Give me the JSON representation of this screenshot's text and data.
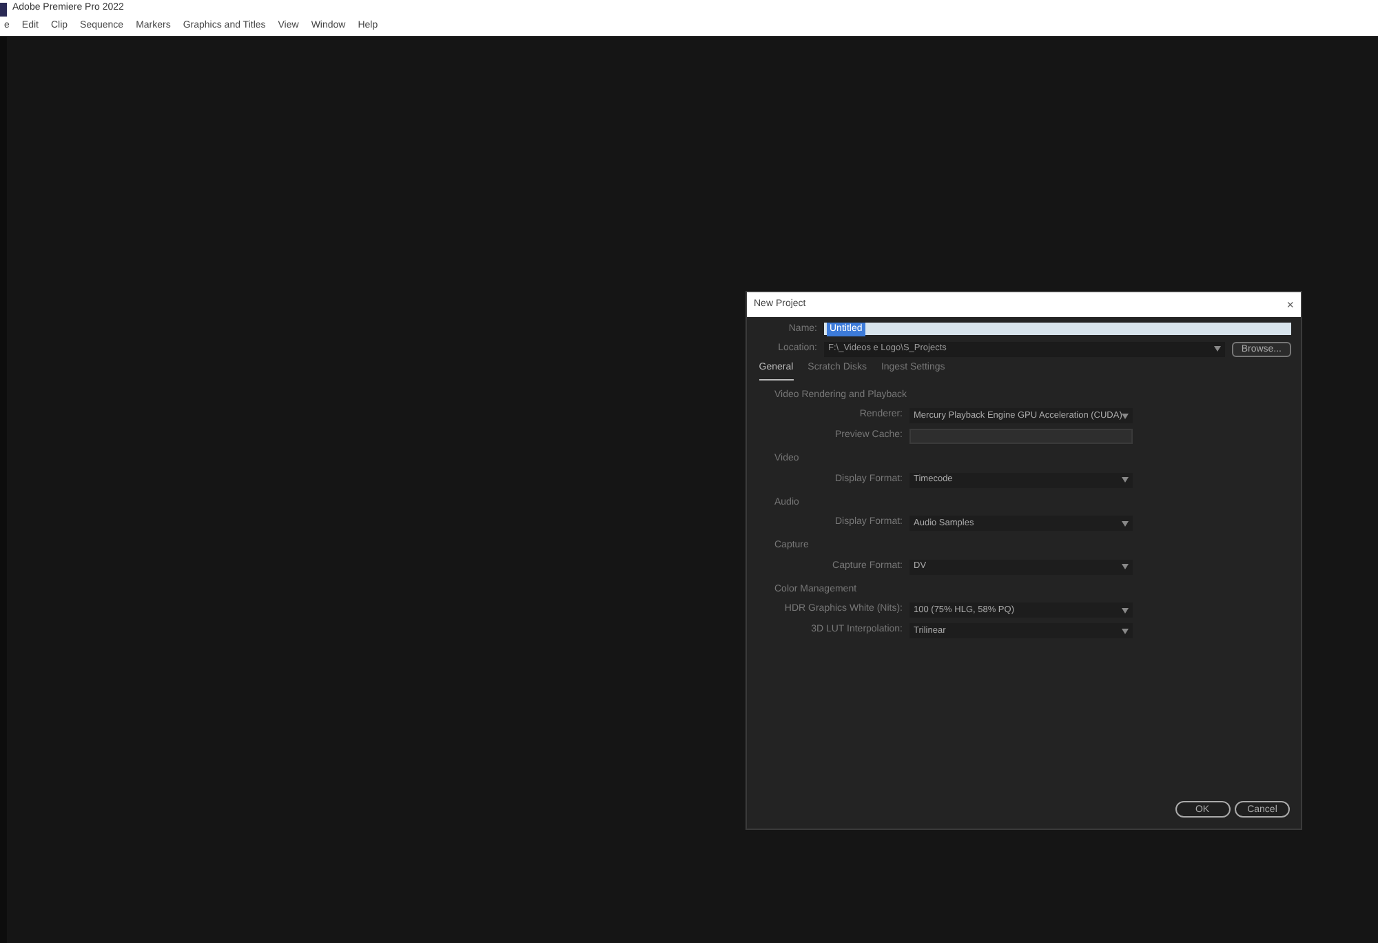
{
  "app_title": "Adobe Premiere Pro 2022",
  "menu": [
    "e",
    "Edit",
    "Clip",
    "Sequence",
    "Markers",
    "Graphics and Titles",
    "View",
    "Window",
    "Help"
  ],
  "dialog": {
    "title": "New Project",
    "close": "×",
    "name": {
      "label": "Name:",
      "value": "Untitled",
      "value_selected": true
    },
    "location": {
      "label": "Location:",
      "value": "F:\\_Videos e Logo\\S_Projects",
      "button": "Browse..."
    },
    "tabs": [
      {
        "label": "General",
        "selected": true
      },
      {
        "label": "Scratch Disks",
        "selected": false
      },
      {
        "label": "Ingest Settings",
        "selected": false
      }
    ],
    "sections": [
      {
        "title": "Video Rendering and Playback",
        "rows": [
          {
            "label": "Renderer:",
            "value": "Mercury Playback Engine GPU Acceleration (CUDA)",
            "disabled": false
          },
          {
            "label": "Preview Cache:",
            "disabled": true
          }
        ]
      },
      {
        "title": "Video",
        "rows": [
          {
            "label": "Display Format:",
            "value": "Timecode",
            "disabled": false
          }
        ]
      },
      {
        "title": "Audio",
        "rows": [
          {
            "label": "Display Format:",
            "value": "Audio Samples",
            "disabled": false
          }
        ]
      },
      {
        "title": "Capture",
        "rows": [
          {
            "label": "Capture Format:",
            "value": "DV",
            "disabled": false
          }
        ]
      },
      {
        "title": "Color Management",
        "rows": [
          {
            "label": "HDR Graphics White (Nits):",
            "value": "100 (75% HLG, 58% PQ)",
            "disabled": false
          },
          {
            "label": "3D LUT Interpolation:",
            "value": "Trilinear",
            "disabled": false
          }
        ]
      }
    ],
    "buttons": [
      "OK",
      "Cancel"
    ]
  }
}
